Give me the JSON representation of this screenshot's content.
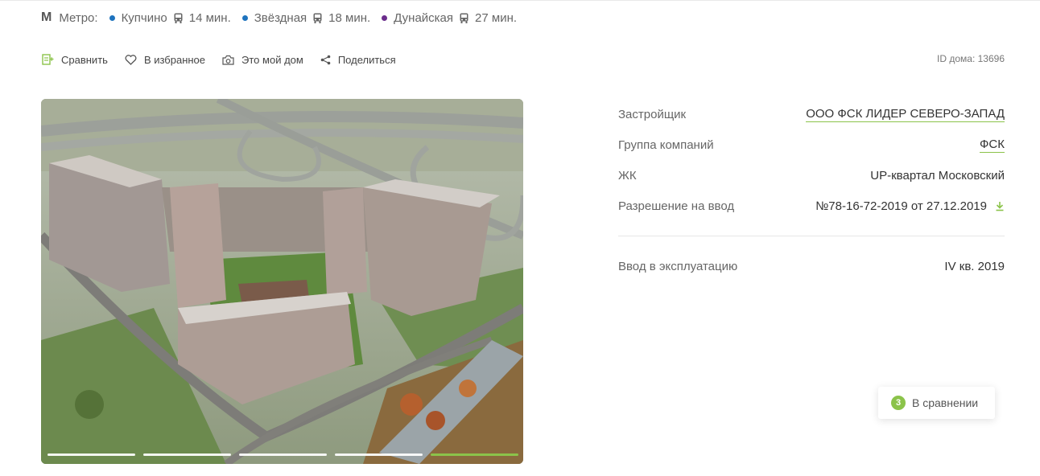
{
  "metro": {
    "label": "Метро:",
    "stations": [
      {
        "name": "Купчино",
        "color": "#1e73be",
        "time": "14 мин."
      },
      {
        "name": "Звёздная",
        "color": "#1e73be",
        "time": "18 мин."
      },
      {
        "name": "Дунайская",
        "color": "#6b2d8c",
        "time": "27 мин."
      }
    ]
  },
  "actions": {
    "compare": "Сравнить",
    "favorite": "В избранное",
    "my_home": "Это мой дом",
    "share": "Поделиться"
  },
  "house_id": "ID дома: 13696",
  "gallery": {
    "slides": 5,
    "active": 5
  },
  "info": {
    "developer_label": "Застройщик",
    "developer_value": "ООО ФСК ЛИДЕР СЕВЕРО-ЗАПАД",
    "group_label": "Группа компаний",
    "group_value": "ФСК",
    "complex_label": "ЖК",
    "complex_value": "UP-квартал Московский",
    "permit_label": "Разрешение на ввод",
    "permit_value": "№78-16-72-2019 от 27.12.2019",
    "commission_label": "Ввод в эксплуатацию",
    "commission_value": "IV кв. 2019"
  },
  "compare_badge": {
    "count": "3",
    "label": "В сравнении"
  },
  "colors": {
    "accent": "#8bc34a",
    "metro_blue": "#1e73be",
    "metro_purple": "#6b2d8c"
  }
}
